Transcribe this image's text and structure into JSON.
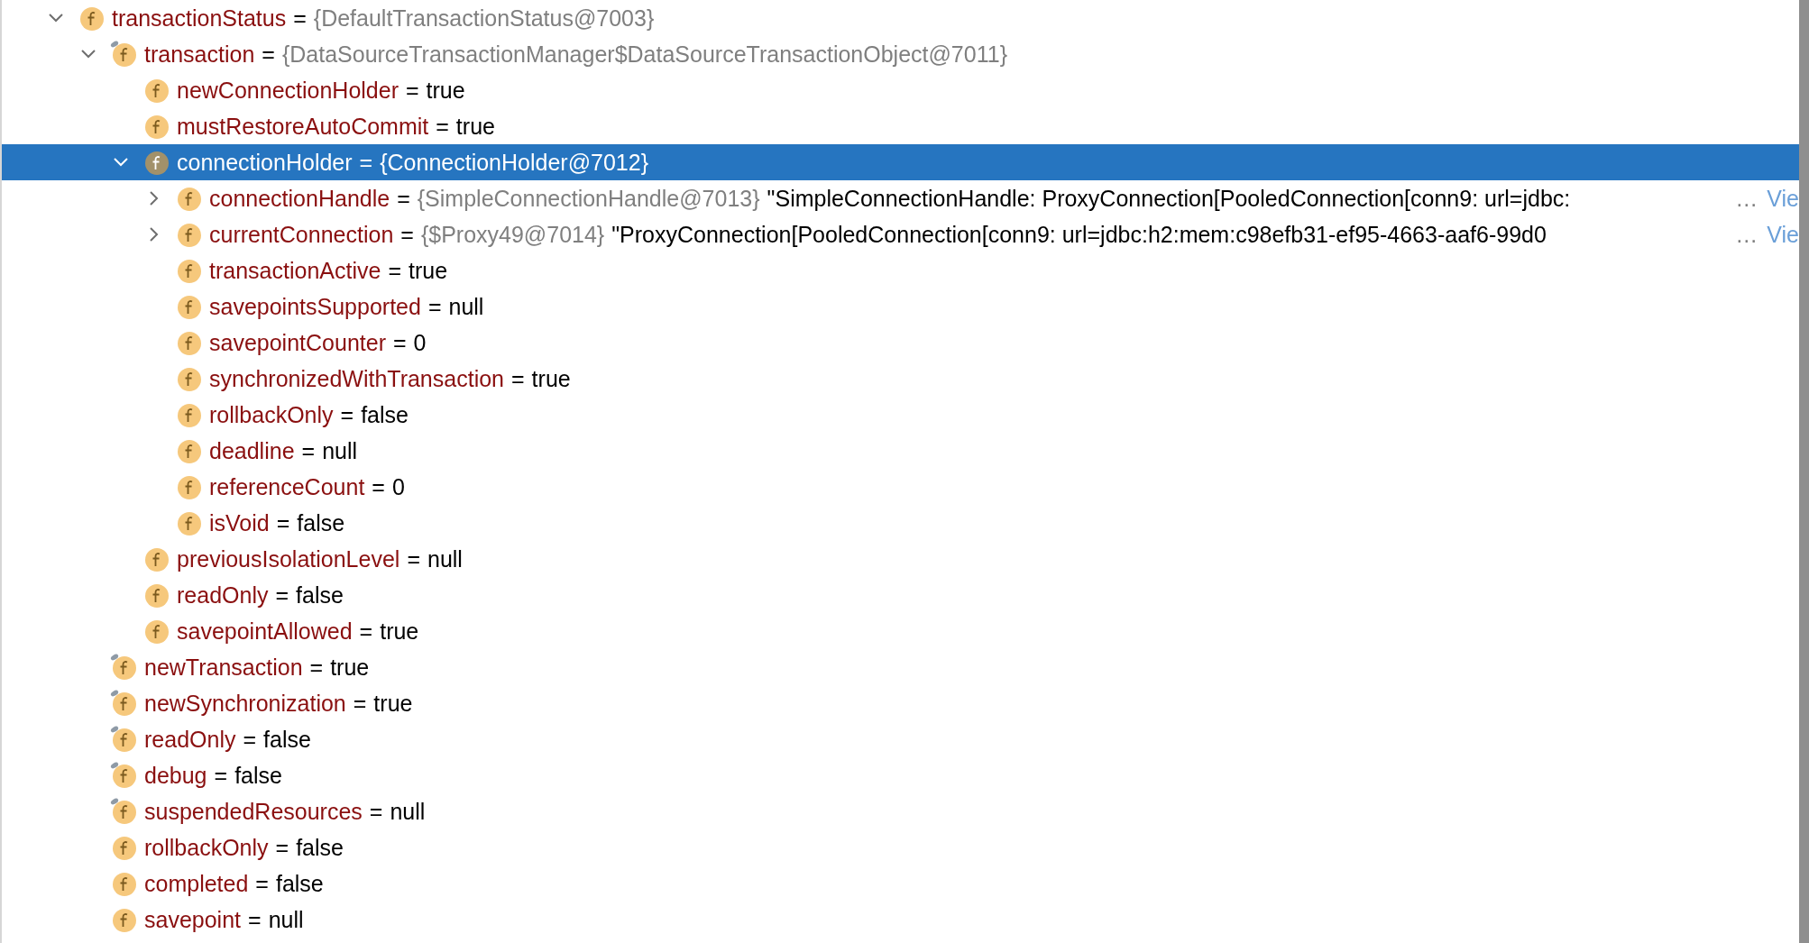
{
  "tree": [
    {
      "name": "transactionStatus",
      "equals": "=",
      "type": "{DefaultTransactionStatus@7003}",
      "expanded": true,
      "selected": false,
      "marked": false,
      "children": [
        {
          "name": "transaction",
          "equals": "=",
          "type": "{DataSourceTransactionManager$DataSourceTransactionObject@7011}",
          "expanded": true,
          "selected": false,
          "marked": true,
          "children": [
            {
              "name": "newConnectionHolder",
              "equals": "=",
              "value": "true",
              "selected": false,
              "marked": false
            },
            {
              "name": "mustRestoreAutoCommit",
              "equals": "=",
              "value": "true",
              "selected": false,
              "marked": false
            },
            {
              "name": "connectionHolder",
              "equals": "=",
              "value": "{ConnectionHolder@7012}",
              "expanded": true,
              "selected": true,
              "marked": false,
              "children": [
                {
                  "name": "connectionHandle",
                  "equals": "=",
                  "type": "{SimpleConnectionHandle@7013}",
                  "string": "\"SimpleConnectionHandle: ProxyConnection[PooledConnection[conn9: url=jdbc:",
                  "more": "…",
                  "link": "Vie",
                  "expanded": false,
                  "selected": false,
                  "marked": false
                },
                {
                  "name": "currentConnection",
                  "equals": "=",
                  "type": "{$Proxy49@7014}",
                  "string": "\"ProxyConnection[PooledConnection[conn9: url=jdbc:h2:mem:c98efb31-ef95-4663-aaf6-99d0",
                  "more": "…",
                  "link": "Vie",
                  "expanded": false,
                  "selected": false,
                  "marked": false
                },
                {
                  "name": "transactionActive",
                  "equals": "=",
                  "value": "true",
                  "selected": false,
                  "marked": false
                },
                {
                  "name": "savepointsSupported",
                  "equals": "=",
                  "value": "null",
                  "selected": false,
                  "marked": false
                },
                {
                  "name": "savepointCounter",
                  "equals": "=",
                  "value": "0",
                  "selected": false,
                  "marked": false
                },
                {
                  "name": "synchronizedWithTransaction",
                  "equals": "=",
                  "value": "true",
                  "selected": false,
                  "marked": false
                },
                {
                  "name": "rollbackOnly",
                  "equals": "=",
                  "value": "false",
                  "selected": false,
                  "marked": false
                },
                {
                  "name": "deadline",
                  "equals": "=",
                  "value": "null",
                  "selected": false,
                  "marked": false
                },
                {
                  "name": "referenceCount",
                  "equals": "=",
                  "value": "0",
                  "selected": false,
                  "marked": false
                },
                {
                  "name": "isVoid",
                  "equals": "=",
                  "value": "false",
                  "selected": false,
                  "marked": false
                }
              ]
            },
            {
              "name": "previousIsolationLevel",
              "equals": "=",
              "value": "null",
              "selected": false,
              "marked": false
            },
            {
              "name": "readOnly",
              "equals": "=",
              "value": "false",
              "selected": false,
              "marked": false
            },
            {
              "name": "savepointAllowed",
              "equals": "=",
              "value": "true",
              "selected": false,
              "marked": false
            }
          ]
        },
        {
          "name": "newTransaction",
          "equals": "=",
          "value": "true",
          "selected": false,
          "marked": true
        },
        {
          "name": "newSynchronization",
          "equals": "=",
          "value": "true",
          "selected": false,
          "marked": true
        },
        {
          "name": "readOnly",
          "equals": "=",
          "value": "false",
          "selected": false,
          "marked": true
        },
        {
          "name": "debug",
          "equals": "=",
          "value": "false",
          "selected": false,
          "marked": true
        },
        {
          "name": "suspendedResources",
          "equals": "=",
          "value": "null",
          "selected": false,
          "marked": true
        },
        {
          "name": "rollbackOnly",
          "equals": "=",
          "value": "false",
          "selected": false,
          "marked": false
        },
        {
          "name": "completed",
          "equals": "=",
          "value": "false",
          "selected": false,
          "marked": false
        },
        {
          "name": "savepoint",
          "equals": "=",
          "value": "null",
          "selected": false,
          "marked": false
        }
      ]
    }
  ]
}
